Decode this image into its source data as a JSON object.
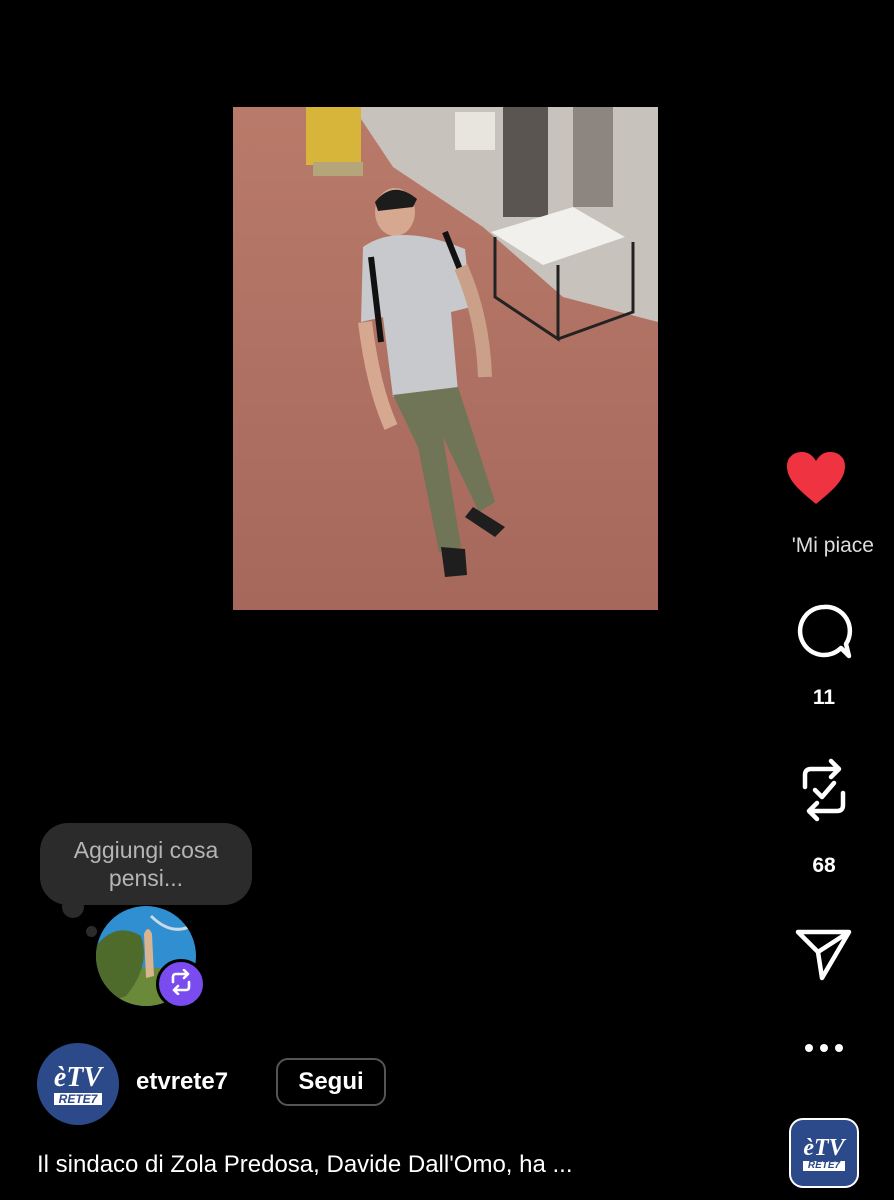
{
  "post": {
    "media_description": "",
    "caption": "Il sindaco di Zola Predosa, Davide Dall'Omo, ha ..."
  },
  "actions": {
    "likes_label": "'Mi piace",
    "comments_count": "11",
    "reposts_count": "68",
    "like_color": "#ef3340"
  },
  "note": {
    "placeholder": "Aggiungi cosa pensi..."
  },
  "author": {
    "username": "etvrete7",
    "follow_label": "Segui",
    "logo_top": "èTV",
    "logo_bottom": "RETE7"
  },
  "icons": {
    "like": "heart-icon",
    "comment": "comment-icon",
    "repost": "repost-icon",
    "share": "send-icon",
    "more": "more-icon"
  }
}
